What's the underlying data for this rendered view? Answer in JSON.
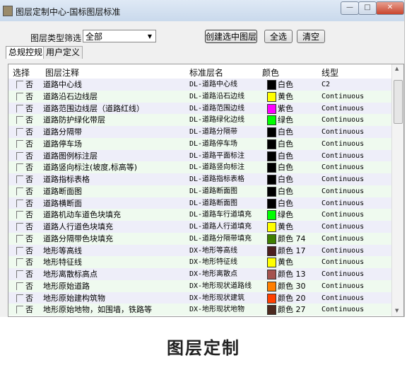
{
  "window": {
    "title": "图层定制中心-国标图层标准",
    "min": "—",
    "max": "□",
    "close": "✕"
  },
  "filter": {
    "label": "图层类型筛选：",
    "value": "全部"
  },
  "buttons": {
    "create": "创建选中图层",
    "select_all": "全选",
    "clear": "清空"
  },
  "tabs": [
    {
      "label": "总规控规"
    },
    {
      "label": "用户定义"
    }
  ],
  "table": {
    "headers": [
      "选择",
      "图层注释",
      "标准层名",
      "颜色",
      "线型"
    ],
    "rows": [
      {
        "check": "否",
        "note": "道路中心线",
        "name": "DL-道路中心线",
        "color": "白色",
        "swatch": "#000000",
        "ltype": "C2"
      },
      {
        "check": "否",
        "note": "道路沿石边线层",
        "name": "DL-道路沿石边线",
        "color": "黄色",
        "swatch": "#ffff00",
        "ltype": "Continuous"
      },
      {
        "check": "否",
        "note": "道路范围边线层（道路红线）",
        "name": "DL-道路范围边线",
        "color": "紫色",
        "swatch": "#ff00ff",
        "ltype": "Continuous"
      },
      {
        "check": "否",
        "note": "道路防护绿化带层",
        "name": "DL-道路绿化边线",
        "color": "绿色",
        "swatch": "#00ff00",
        "ltype": "Continuous"
      },
      {
        "check": "否",
        "note": "道路分隔带",
        "name": "DL-道路分隔带",
        "color": "白色",
        "swatch": "#000000",
        "ltype": "Continuous"
      },
      {
        "check": "否",
        "note": "道路停车场",
        "name": "DL-道路停车场",
        "color": "白色",
        "swatch": "#000000",
        "ltype": "Continuous"
      },
      {
        "check": "否",
        "note": "道路图例标注层",
        "name": "DL-道路平面标注",
        "color": "白色",
        "swatch": "#000000",
        "ltype": "Continuous"
      },
      {
        "check": "否",
        "note": "道路竖向标注(坡度,标高等)",
        "name": "DL-道路竖向标注",
        "color": "白色",
        "swatch": "#000000",
        "ltype": "Continuous"
      },
      {
        "check": "否",
        "note": "道路指标表格",
        "name": "DL-道路指标表格",
        "color": "白色",
        "swatch": "#000000",
        "ltype": "Continuous"
      },
      {
        "check": "否",
        "note": "道路断面图",
        "name": "DL-道路断面图",
        "color": "白色",
        "swatch": "#000000",
        "ltype": "Continuous"
      },
      {
        "check": "否",
        "note": "道路横断面",
        "name": "DL-道路断面图",
        "color": "白色",
        "swatch": "#000000",
        "ltype": "Continuous"
      },
      {
        "check": "否",
        "note": "道路机动车道色块填充",
        "name": "DL-道路车行道填充",
        "color": "绿色",
        "swatch": "#00ff00",
        "ltype": "Continuous"
      },
      {
        "check": "否",
        "note": "道路人行道色块填充",
        "name": "DL-道路人行道填充",
        "color": "黄色",
        "swatch": "#ffff00",
        "ltype": "Continuous"
      },
      {
        "check": "否",
        "note": "道路分隔带色块填充",
        "name": "DL-道路分隔带填充",
        "color": "颜色 74",
        "swatch": "#3f7f00",
        "ltype": "Continuous"
      },
      {
        "check": "否",
        "note": "地形等高线",
        "name": "DX-地形等高线",
        "color": "颜色 17",
        "swatch": "#4c1f1f",
        "ltype": "Continuous"
      },
      {
        "check": "否",
        "note": "地形特征线",
        "name": "DX-地形特征线",
        "color": "黄色",
        "swatch": "#ffff00",
        "ltype": "Continuous"
      },
      {
        "check": "否",
        "note": "地形离散标高点",
        "name": "DX-地形离散点",
        "color": "颜色 13",
        "swatch": "#a5524f",
        "ltype": "Continuous"
      },
      {
        "check": "否",
        "note": "地形原始道路",
        "name": "DX-地形现状道路线",
        "color": "颜色 30",
        "swatch": "#ff7f00",
        "ltype": "Continuous"
      },
      {
        "check": "否",
        "note": "地形原始建构筑物",
        "name": "DX-地形现状建筑",
        "color": "颜色 20",
        "swatch": "#ff3f00",
        "ltype": "Continuous"
      },
      {
        "check": "否",
        "note": "地形原始地物，如围墙，铁路等",
        "name": "DX-地形现状地物",
        "color": "颜色 27",
        "swatch": "#4c2a1f",
        "ltype": "Continuous"
      }
    ]
  },
  "caption": "图层定制",
  "colors": {
    "row_odd": "#eeeef9",
    "row_even": "#effaef"
  }
}
